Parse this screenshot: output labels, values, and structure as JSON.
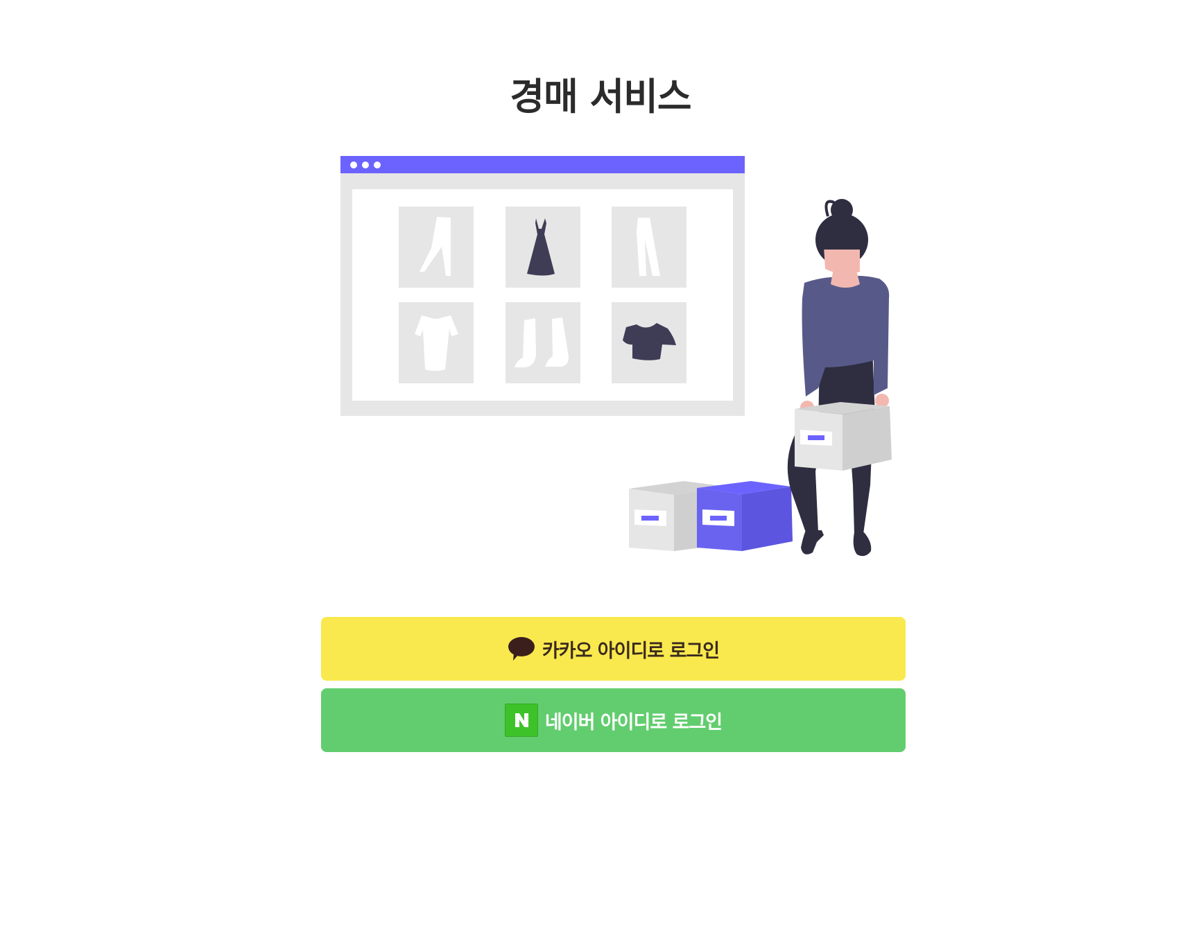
{
  "page": {
    "title": "경매 서비스"
  },
  "illustration": {
    "icon": "online-shop-illustration",
    "accent_color": "#6c63ff"
  },
  "login": {
    "kakao": {
      "label": "카카오 아이디로 로그인",
      "icon": "kakao-speech-bubble-icon",
      "bg_color": "#f9e94e"
    },
    "naver": {
      "label": "네이버 아이디로 로그인",
      "icon": "naver-n-icon",
      "icon_text": "N",
      "bg_color": "#62cd6e"
    }
  }
}
